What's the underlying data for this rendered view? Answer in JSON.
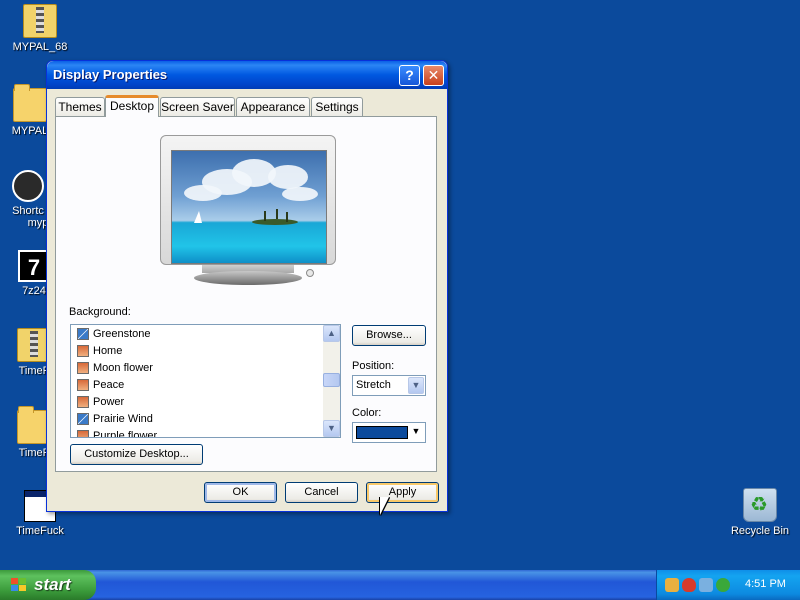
{
  "desktop": {
    "icons": [
      {
        "label": "MYPAL_68"
      },
      {
        "label": "MYPAL"
      },
      {
        "label": "Shortc"
      },
      {
        "label": "myp"
      },
      {
        "label": "7z24"
      },
      {
        "label": "TimeF"
      },
      {
        "label": "TimeF"
      },
      {
        "label": "TimeFuck"
      },
      {
        "label": "Recycle Bin"
      }
    ]
  },
  "dialog": {
    "title": "Display Properties",
    "help_glyph": "?",
    "close_glyph": "✕",
    "tabs": [
      {
        "label": "Themes"
      },
      {
        "label": "Desktop"
      },
      {
        "label": "Screen Saver"
      },
      {
        "label": "Appearance"
      },
      {
        "label": "Settings"
      }
    ],
    "active_tab": "Desktop",
    "background_label": "Background:",
    "background_items": [
      {
        "label": "Greenstone"
      },
      {
        "label": "Home"
      },
      {
        "label": "Moon flower"
      },
      {
        "label": "Peace"
      },
      {
        "label": "Power"
      },
      {
        "label": "Prairie Wind"
      },
      {
        "label": "Purple flower"
      }
    ],
    "browse_label": "Browse...",
    "position_label": "Position:",
    "position_value": "Stretch",
    "color_label": "Color:",
    "color_value": "#0b4a9c",
    "customize_label": "Customize Desktop...",
    "ok_label": "OK",
    "cancel_label": "Cancel",
    "apply_label": "Apply"
  },
  "taskbar": {
    "start_label": "start",
    "clock": "4:51 PM"
  },
  "colors": {
    "desktop_bg": "#0b4a9c",
    "title_blue": "#0058e0",
    "dialog_bg": "#ece9d8",
    "start_green": "#3a9a3a",
    "active_tab_accent": "#e68b2c"
  }
}
